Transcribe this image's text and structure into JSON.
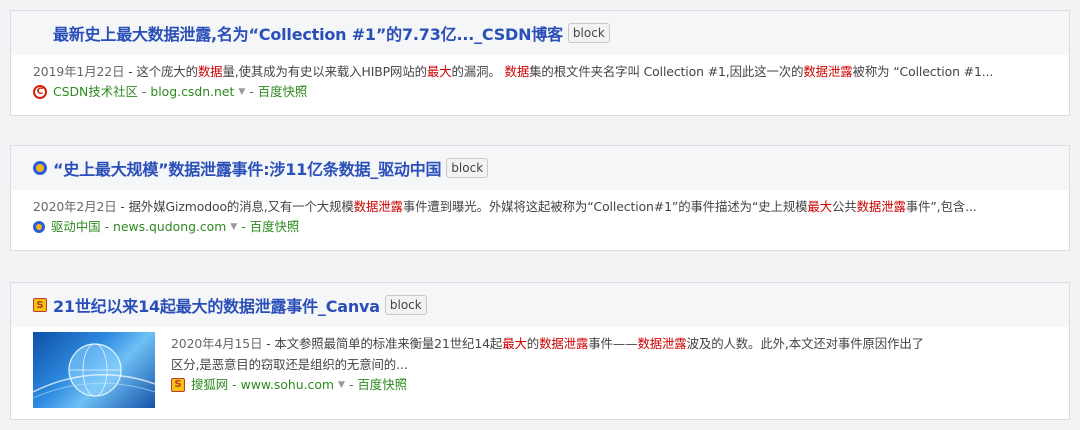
{
  "results": [
    {
      "title": "最新史上最大数据泄露,名为“Collection #1”的7.73亿..._CSDN博客",
      "block_label": "block",
      "date": "2019年1月22日",
      "abstract_parts": [
        " - 这个庞大的",
        "数据",
        "量,使其成为有史以来载入HIBP网站的",
        "最大",
        "的漏洞。 ",
        "数据",
        "集的根文件夹名字叫 Collection #1,因此这一次的",
        "数据泄露",
        "被称为 “Collection #1..."
      ],
      "source_name": "CSDN技术社区",
      "source_url": "blog.csdn.net",
      "snapshot": "百度快照",
      "sep": "-"
    },
    {
      "title": "“史上最大规模”数据泄露事件:涉11亿条数据_驱动中国",
      "block_label": "block",
      "date": "2020年2月2日",
      "abstract_parts": [
        " - 据外媒Gizmodoo的消息,又有一个大规模",
        "数据泄露",
        "事件遭到曝光。外媒将这起被称为“Collection#1”的事件描述为“史上规模",
        "最大",
        "公共",
        "数据泄露",
        "事件”,包含..."
      ],
      "source_name": "驱动中国",
      "source_url": "news.qudong.com",
      "snapshot": "百度快照",
      "sep": "-"
    },
    {
      "title": "21世纪以来14起最大的数据泄露事件_Canva",
      "block_label": "block",
      "date": "2020年4月15日",
      "abstract_line1_parts": [
        " - 本文参照最简单的标准来衡量21世纪14起",
        "最大",
        "的",
        "数据泄露",
        "事件——",
        "数据泄露",
        "波及的人数。此外,本文还对事件原因作出了"
      ],
      "abstract_line2": "区分,是恶意目的窃取还是组织的无意间的...",
      "source_name": "搜狐网",
      "source_url": "www.sohu.com",
      "snapshot": "百度快照",
      "sep": "-"
    }
  ],
  "icons": {
    "r0": "csdn-favicon-icon",
    "r1": "qudong-favicon-icon",
    "r2": "sohu-favicon-icon",
    "thumb": "globe-network-thumbnail"
  },
  "colors": {
    "title": "#2a4fb8",
    "highlight": "#cc0000",
    "source": "#2d8a1e"
  }
}
